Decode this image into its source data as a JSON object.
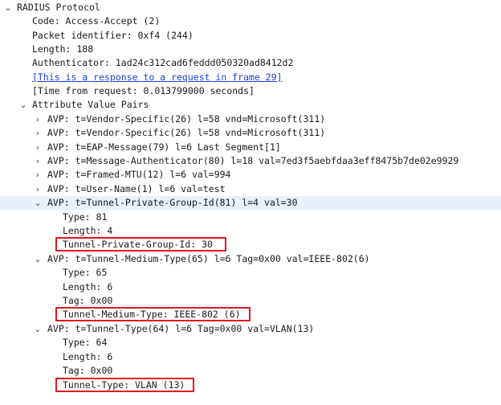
{
  "tree": {
    "root": "RADIUS Protocol",
    "code": "Code: Access-Accept (2)",
    "packet_id": "Packet identifier: 0xf4 (244)",
    "length": "Length: 188",
    "authenticator": "Authenticator: 1ad24c312cad6feddd050320ad8412d2",
    "response_link": "[This is a response to a request in frame 29]",
    "time_from_request": "[Time from request: 0.013799000 seconds]",
    "avp_header": "Attribute Value Pairs",
    "avps": [
      "AVP: t=Vendor-Specific(26) l=58 vnd=Microsoft(311)",
      "AVP: t=Vendor-Specific(26) l=58 vnd=Microsoft(311)",
      "AVP: t=EAP-Message(79) l=6 Last Segment[1]",
      "AVP: t=Message-Authenticator(80) l=18 val=7ed3f5aebfdaa3eff8475b7de02e9929",
      "AVP: t=Framed-MTU(12) l=6 val=994",
      "AVP: t=User-Name(1) l=6 val=test"
    ],
    "tpg": {
      "header": "AVP: t=Tunnel-Private-Group-Id(81) l=4 val=30",
      "type": "Type: 81",
      "length": "Length: 4",
      "value": "Tunnel-Private-Group-Id: 30"
    },
    "tmt": {
      "header": "AVP: t=Tunnel-Medium-Type(65) l=6 Tag=0x00 val=IEEE-802(6)",
      "type": "Type: 65",
      "length": "Length: 6",
      "tag": "Tag: 0x00",
      "value": "Tunnel-Medium-Type: IEEE-802 (6)"
    },
    "tt": {
      "header": "AVP: t=Tunnel-Type(64) l=6 Tag=0x00 val=VLAN(13)",
      "type": "Type: 64",
      "length": "Length: 6",
      "tag": "Tag: 0x00",
      "value": "Tunnel-Type: VLAN (13)"
    }
  },
  "colors": {
    "highlight_border": "#e0161e",
    "selected_row": "#e8f1fb",
    "link": "#1a3fd6"
  }
}
